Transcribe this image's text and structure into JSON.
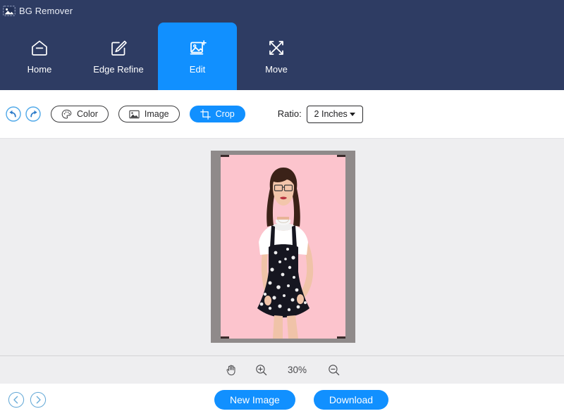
{
  "app": {
    "title": "BG Remover",
    "logo_icon": "photo-icon",
    "accent_color": "#1190ff",
    "header_color": "#2e3c63",
    "canvas_color": "#eeeef0"
  },
  "tabs": [
    {
      "label": "Home",
      "icon": "home-icon",
      "active": false
    },
    {
      "label": "Edge Refine",
      "icon": "pen-square-icon",
      "active": false
    },
    {
      "label": "Edit",
      "icon": "image-edit-icon",
      "active": true
    },
    {
      "label": "Move",
      "icon": "move-arrows-icon",
      "active": false
    }
  ],
  "toolbar": {
    "undo_icon": "undo-arrow-icon",
    "redo_icon": "redo-arrow-icon",
    "buttons": [
      {
        "label": "Color",
        "icon": "palette-icon",
        "active": false
      },
      {
        "label": "Image",
        "icon": "picture-icon",
        "active": false
      },
      {
        "label": "Crop",
        "icon": "crop-icon",
        "active": true
      }
    ],
    "ratio_label": "Ratio:",
    "ratio_value": "2 Inches",
    "ratio_options": [
      "2 Inches"
    ]
  },
  "canvas": {
    "background_color": "#fcc4cd",
    "frame_color": "#8f8a8a",
    "crop_handle_color": "#3b2b2b",
    "subject": "woman in black floral pinafore dress over white tee"
  },
  "zoombar": {
    "hand_icon": "hand-icon",
    "zoom_in_icon": "zoom-in-icon",
    "zoom_out_icon": "zoom-out-icon",
    "zoom_level": "30%"
  },
  "footer": {
    "prev_icon": "chevron-left-circle-icon",
    "next_icon": "chevron-right-circle-icon",
    "new_image_label": "New Image",
    "download_label": "Download"
  }
}
